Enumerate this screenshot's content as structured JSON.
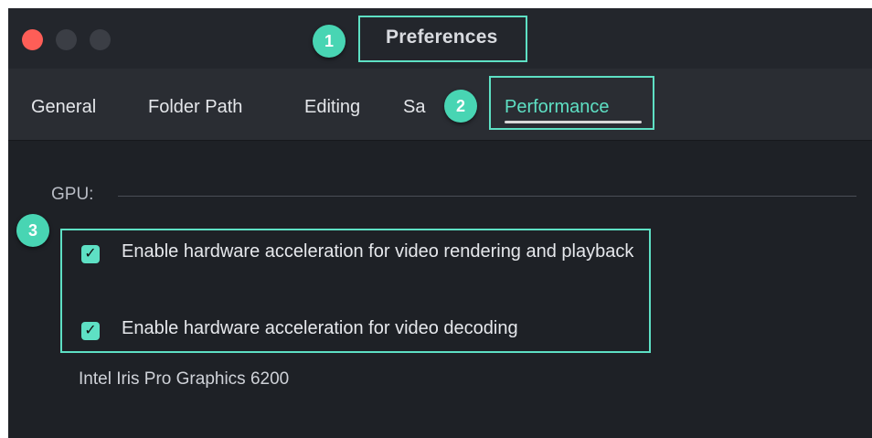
{
  "window": {
    "title": "Preferences"
  },
  "tabs": [
    {
      "label": "General"
    },
    {
      "label": "Folder Path"
    },
    {
      "label": "Editing"
    },
    {
      "label": "Sa"
    },
    {
      "label": "Performance",
      "active": true
    }
  ],
  "gpu": {
    "section_label": "GPU:",
    "options": [
      {
        "label": "Enable hardware acceleration for video rendering and playback",
        "checked": true
      },
      {
        "label": "Enable hardware acceleration for video decoding",
        "checked": true
      }
    ],
    "device_name": "Intel Iris Pro Graphics 6200"
  },
  "annotations": {
    "badge_1": "1",
    "badge_2": "2",
    "badge_3": "3"
  },
  "colors": {
    "accent": "#5ee0c4",
    "close_button": "#fe5e57",
    "background": "#1e2126"
  },
  "icons": {
    "check": "✓"
  }
}
